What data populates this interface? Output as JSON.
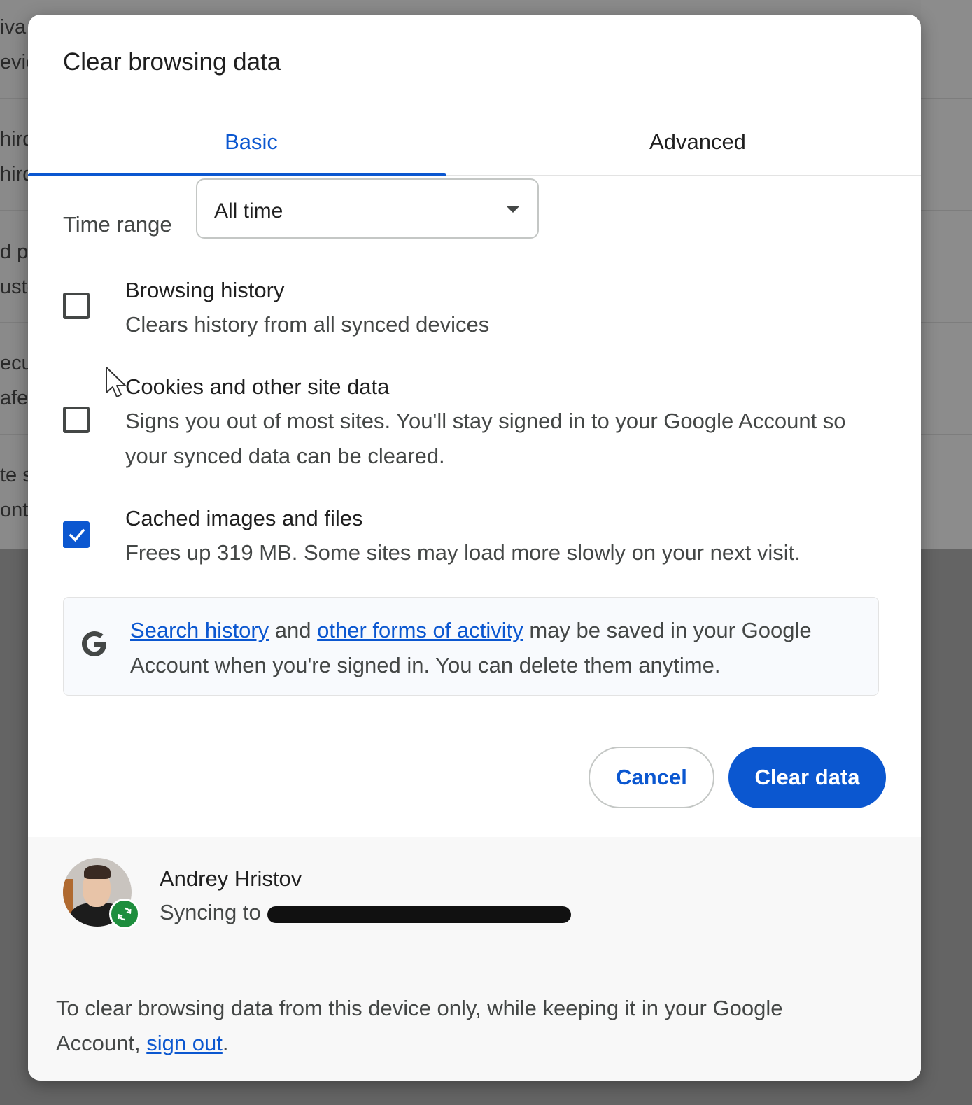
{
  "background": {
    "fragments": [
      "iva",
      "evie",
      "hird",
      "hird",
      "d p",
      "usto",
      "ecu",
      "afe",
      "te s",
      "ont"
    ]
  },
  "dialog": {
    "title": "Clear browsing data",
    "tabs": [
      {
        "label": "Basic",
        "active": true
      },
      {
        "label": "Advanced",
        "active": false
      }
    ],
    "time_range": {
      "label": "Time range",
      "value": "All time"
    },
    "options": [
      {
        "title": "Browsing history",
        "description": "Clears history from all synced devices",
        "checked": false
      },
      {
        "title": "Cookies and other site data",
        "description": "Signs you out of most sites. You'll stay signed in to your Google Account so your synced data can be cleared.",
        "checked": false
      },
      {
        "title": "Cached images and files",
        "description": "Frees up 319 MB. Some sites may load more slowly on your next visit.",
        "checked": true
      }
    ],
    "info": {
      "link1": "Search history",
      "and": "and",
      "link2": "other forms of activity",
      "rest": "may be saved in your Google Account when you're signed in. You can delete them anytime."
    },
    "buttons": {
      "cancel": "Cancel",
      "clear": "Clear data"
    },
    "account": {
      "name": "Andrey Hristov",
      "sync_prefix": "Syncing to"
    },
    "footer": {
      "text": "To clear browsing data from this device only, while keeping it in your Google Account,",
      "link": "sign out",
      "suffix": "."
    }
  },
  "colors": {
    "accent": "#0b57d0",
    "sync_green": "#1e8e3e"
  }
}
